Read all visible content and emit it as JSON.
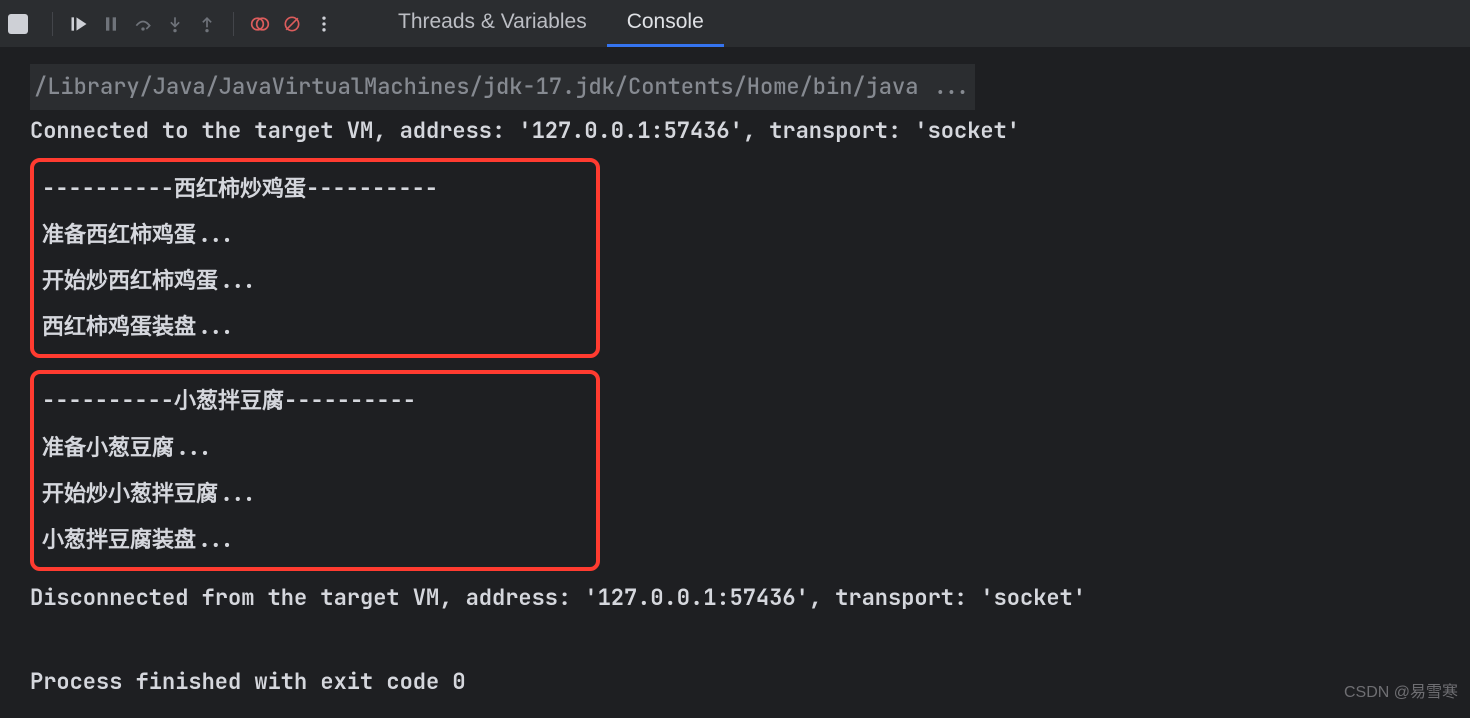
{
  "toolbar": {
    "icons": {
      "stop": "stop",
      "resume": "resume",
      "pause": "pause",
      "step_over": "step-over",
      "step_into": "step-into",
      "step_out": "step-out",
      "breakpoint_on": "breakpoint-on",
      "breakpoint_muted": "breakpoint-muted",
      "more": "more"
    }
  },
  "tabs": {
    "threads_label": "Threads & Variables",
    "console_label": "Console"
  },
  "console": {
    "java_path": "/Library/Java/JavaVirtualMachines/jdk-17.jdk/Contents/Home/bin/java ...",
    "connected": "Connected to the target VM, address: '127.0.0.1:57436', transport: 'socket'",
    "block1": {
      "header": "----------西红柿炒鸡蛋----------",
      "line1": "准备西红柿鸡蛋...",
      "line2": "开始炒西红柿鸡蛋...",
      "line3": "西红柿鸡蛋装盘..."
    },
    "block2": {
      "header": "----------小葱拌豆腐----------",
      "line1": "准备小葱豆腐...",
      "line2": "开始炒小葱拌豆腐...",
      "line3": "小葱拌豆腐装盘..."
    },
    "disconnected": "Disconnected from the target VM, address: '127.0.0.1:57436', transport: 'socket'",
    "exit": "Process finished with exit code 0"
  },
  "watermark": "CSDN @易雪寒"
}
